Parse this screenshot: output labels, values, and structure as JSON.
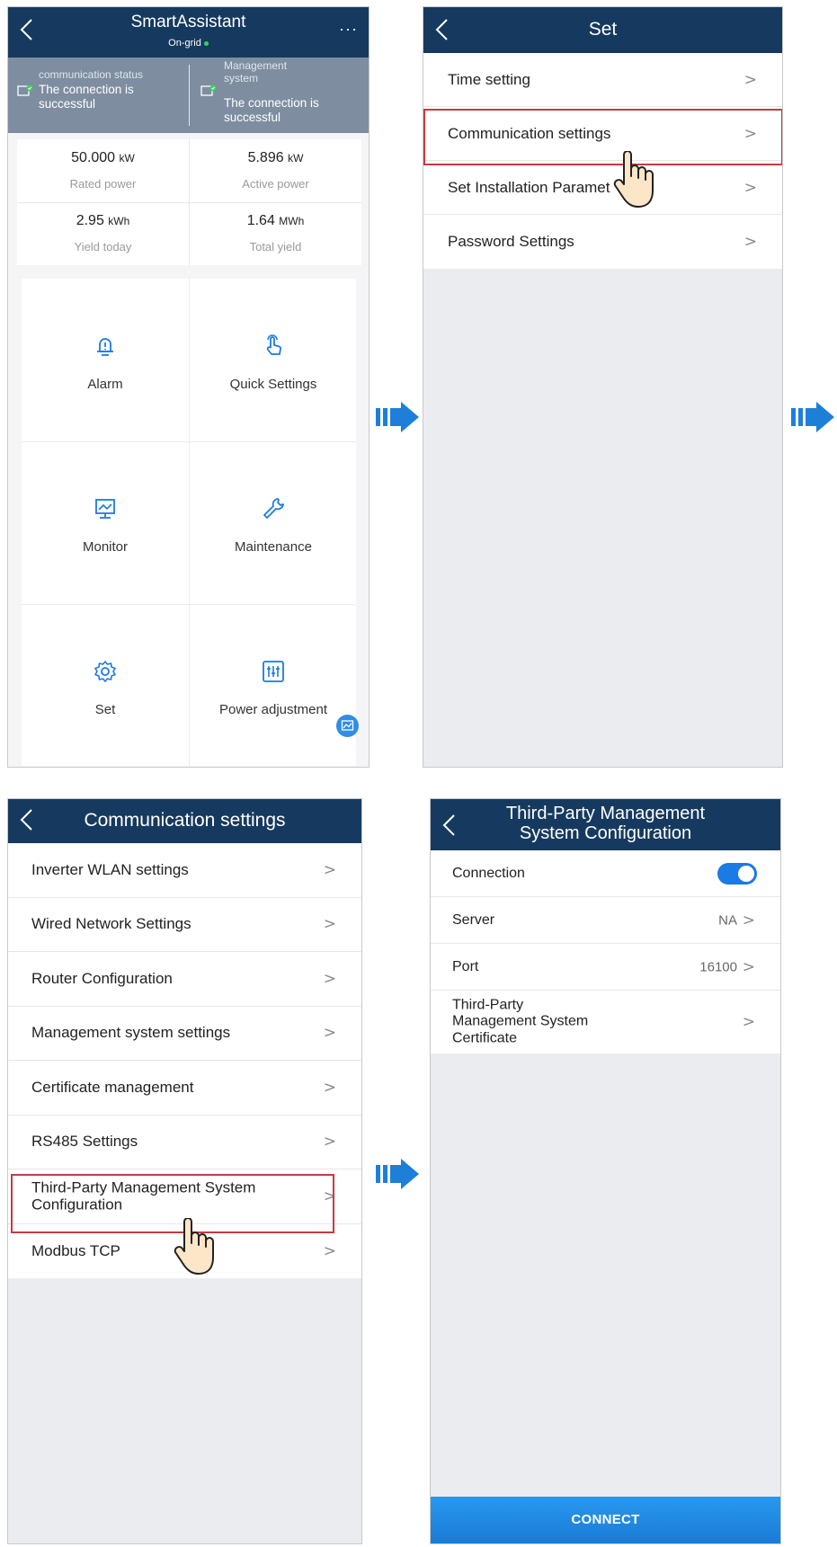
{
  "panel1": {
    "title": "SmartAssistant",
    "subtitle": "On-grid",
    "more": "···",
    "status": {
      "left_label": "communication status",
      "left_value": "The connection is successful",
      "right_label": "Management system",
      "right_value": "The connection is successful"
    },
    "kpis": [
      {
        "value": "50.000",
        "unit": "kW",
        "label": "Rated power"
      },
      {
        "value": "5.896",
        "unit": "kW",
        "label": "Active power"
      },
      {
        "value": "2.95",
        "unit": "kWh",
        "label": "Yield today"
      },
      {
        "value": "1.64",
        "unit": "MWh",
        "label": "Total yield"
      }
    ],
    "tiles": [
      {
        "label": "Alarm",
        "icon": "alarm-bell-icon"
      },
      {
        "label": "Quick Settings",
        "icon": "touch-hand-icon"
      },
      {
        "label": "Monitor",
        "icon": "monitor-icon"
      },
      {
        "label": "Maintenance",
        "icon": "wrench-icon"
      },
      {
        "label": "Set",
        "icon": "gear-icon"
      },
      {
        "label": "Power adjustment",
        "icon": "sliders-icon"
      }
    ]
  },
  "panel2": {
    "title": "Set",
    "items": [
      "Time setting",
      "Communication settings",
      "Set Installation Paramet",
      "Password Settings"
    ]
  },
  "panel3": {
    "title": "Communication settings",
    "items": [
      "Inverter WLAN settings",
      "Wired Network Settings",
      "Router Configuration",
      "Management system settings",
      "Certificate management",
      "RS485 Settings",
      "Third-Party Management System Configuration",
      "Modbus TCP"
    ]
  },
  "panel4": {
    "title_line1": "Third-Party Management",
    "title_line2": "System Configuration",
    "connection_label": "Connection",
    "connection_on": true,
    "server_label": "Server",
    "server_value": "NA",
    "port_label": "Port",
    "port_value": "16100",
    "cert_label": "Third-Party Management System Certificate",
    "connect_label": "CONNECT"
  },
  "colors": {
    "header": "#163a5f",
    "status_bar": "#7e8ea0",
    "accent": "#1b7ae3",
    "highlight": "#c9393f",
    "arrow": "#1e7fd8"
  }
}
